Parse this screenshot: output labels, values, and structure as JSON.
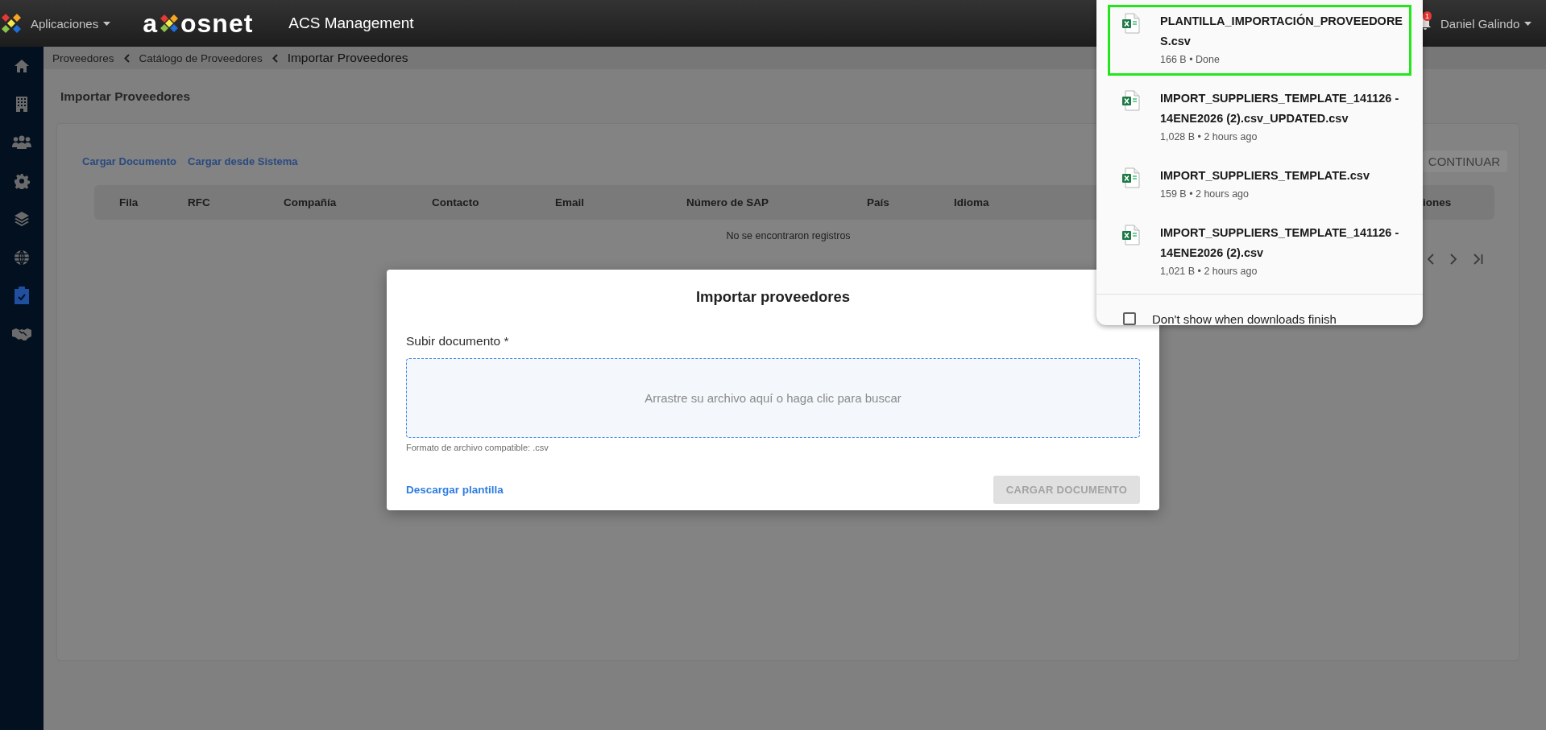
{
  "header": {
    "apps_menu": "Aplicaciones",
    "logo_before": "a",
    "logo_after": "osnet",
    "app_title": "ACS Management",
    "notification_badge": "1",
    "user_menu": "Daniel Galindo"
  },
  "sidebar": {
    "items": [
      {
        "selected": false
      },
      {
        "selected": false
      },
      {
        "selected": false
      },
      {
        "selected": false
      },
      {
        "selected": false
      },
      {
        "selected": false
      },
      {
        "selected": true
      },
      {
        "selected": false
      }
    ]
  },
  "breadcrumb": [
    {
      "label": "Proveedores",
      "current": false
    },
    {
      "label": "Catálogo de Proveedores",
      "current": false
    },
    {
      "label": "Importar Proveedores",
      "current": true
    }
  ],
  "page_title": "Importar Proveedores",
  "actions": {
    "links": [
      "Cargar Documento",
      "Cargar desde Sistema"
    ],
    "continue_button": {
      "label": "CONTINUAR",
      "disabled": true
    }
  },
  "table": {
    "columns": [
      "Fila",
      "RFC",
      "Compañía",
      "Contacto",
      "Email",
      "Número de SAP",
      "País",
      "Idioma",
      "iones"
    ],
    "empty_message": "No se encontraron registros"
  },
  "modal": {
    "title": "Importar proveedores",
    "field_label": "Subir documento *",
    "dropzone_text": "Arrastre su archivo aquí o haga clic para buscar",
    "hint": "Formato de archivo compatible: .csv",
    "template_link": "Descargar plantilla",
    "upload_button": {
      "label": "CARGAR DOCUMENTO",
      "disabled": true
    }
  },
  "downloads": {
    "items": [
      {
        "name": "PLANTILLA_IMPORTACIÓN_PROVEEDORES.csv",
        "meta": "166 B • Done",
        "highlighted": true
      },
      {
        "name": "IMPORT_SUPPLIERS_TEMPLATE_141126 - 14ENE2026 (2).csv_UPDATED.csv",
        "meta": "1,028 B • 2 hours ago",
        "highlighted": false
      },
      {
        "name": "IMPORT_SUPPLIERS_TEMPLATE.csv",
        "meta": "159 B • 2 hours ago",
        "highlighted": false
      },
      {
        "name": "IMPORT_SUPPLIERS_TEMPLATE_141126 - 14ENE2026 (2).csv",
        "meta": "1,021 B • 2 hours ago",
        "highlighted": false
      }
    ],
    "footer": {
      "label": "Don't show when downloads finish",
      "checked": false
    }
  }
}
